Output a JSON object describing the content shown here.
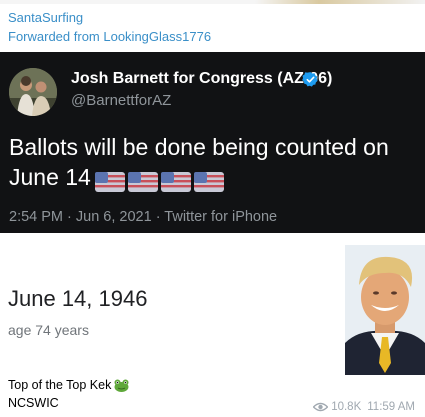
{
  "message": {
    "sender": "SantaSurfing",
    "forwarded_from": "Forwarded from LookingGlass1776"
  },
  "tweet": {
    "author_name": "Josh Barnett for Congress (AZ-06)",
    "handle": "@BarnettforAZ",
    "text": "Ballots will be done being counted on June 14",
    "flag_emoji_count": 4,
    "timestamp": "2:54 PM · Jun 6, 2021 · Twitter for iPhone",
    "verified_icon": "verified-badge-icon"
  },
  "search_result": {
    "date": "June 14, 1946",
    "age": "age 74 years",
    "image": "portrait-photo"
  },
  "caption": {
    "line1": "Top of the Top Kek",
    "line2": "NCSWIC",
    "emoji": "frog-icon"
  },
  "meta": {
    "views": "10.8K",
    "time": "11:59 AM"
  },
  "colors": {
    "link": "#3a8fc8",
    "tweet_bg": "#111214",
    "verified": "#1d9bf0",
    "meta_gray": "#a0a8b0"
  }
}
